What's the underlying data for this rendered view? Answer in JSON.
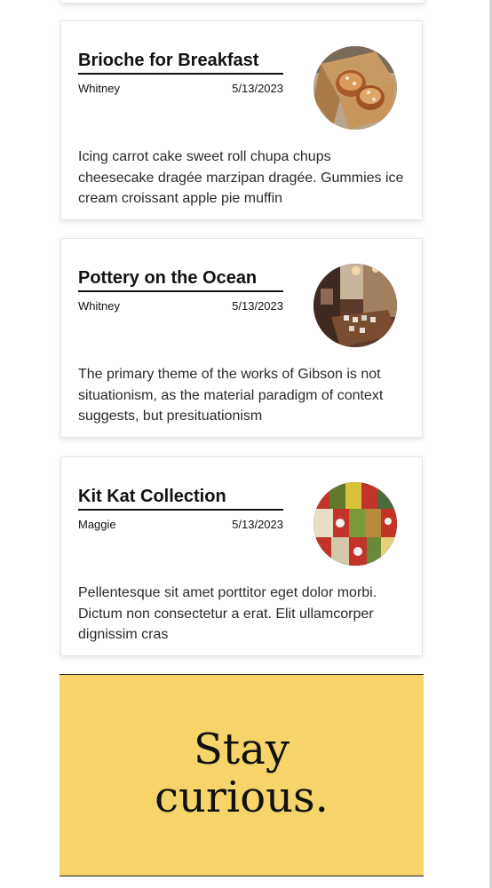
{
  "cards": [
    {
      "title": "Brioche for Breakfast",
      "author": "Whitney",
      "date": "5/13/2023",
      "excerpt": "Icing carrot cake sweet roll chupa chups cheesecake dragée marzipan dragée. Gummies ice cream croissant apple pie muffin",
      "thumbnail": "brioche-photo"
    },
    {
      "title": "Pottery on the Ocean",
      "author": "Whitney",
      "date": "5/13/2023",
      "excerpt": "The primary theme of the works of Gibson is not situationism, as the material paradigm of context suggests, but presituationism",
      "thumbnail": "pottery-studio-photo"
    },
    {
      "title": "Kit Kat Collection",
      "author": "Maggie",
      "date": "5/13/2023",
      "excerpt": "Pellentesque sit amet porttitor eget dolor morbi. Dictum non consectetur a erat. Elit ullamcorper dignissim cras",
      "thumbnail": "kitkat-photo"
    }
  ],
  "banner": {
    "line1": "Stay",
    "line2": "curious.",
    "background": "#f6d46a"
  }
}
